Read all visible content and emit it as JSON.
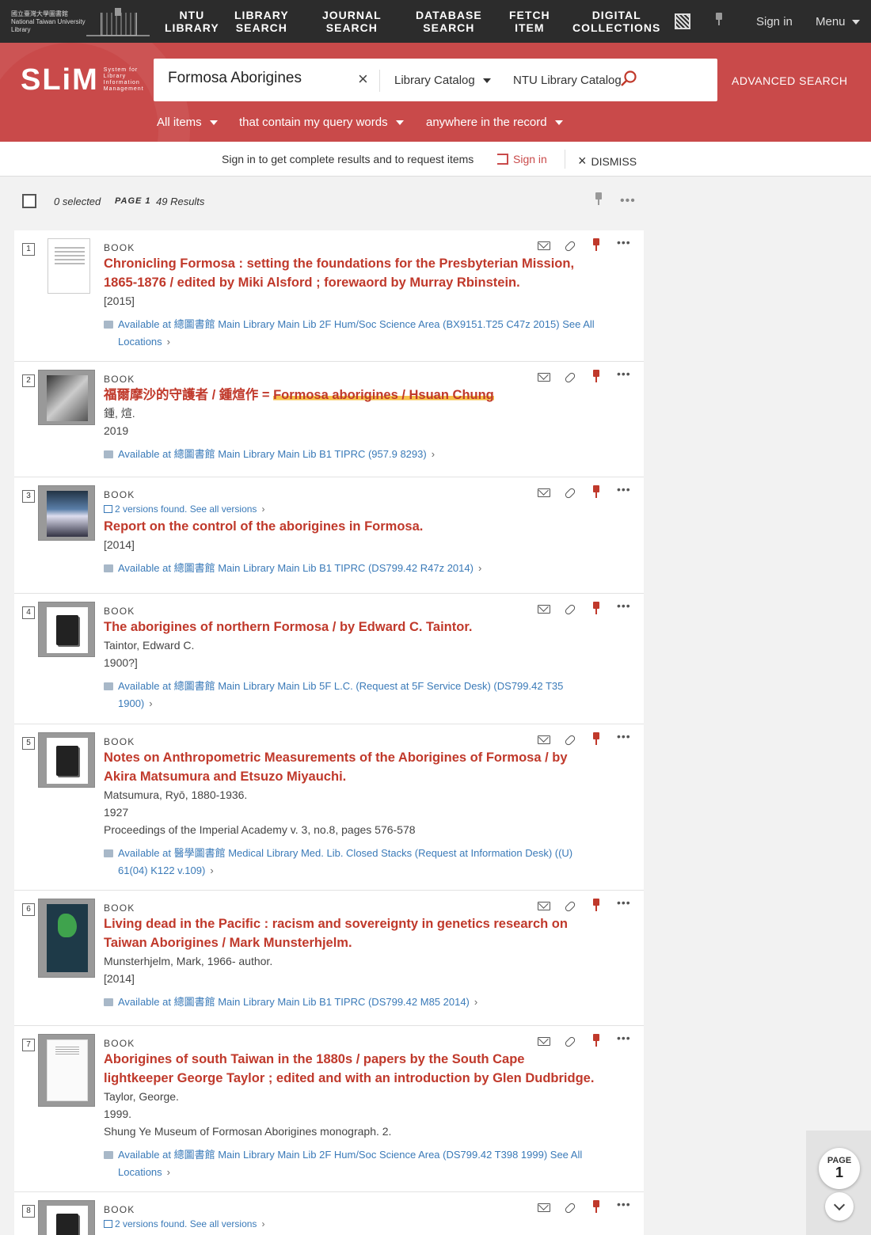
{
  "topnav": {
    "logo_text": "國立臺灣大學圖書館 National Taiwan University Library",
    "items": [
      {
        "line1": "NTU",
        "line2": "LIBRARY"
      },
      {
        "line1": "LIBRARY",
        "line2": "SEARCH"
      },
      {
        "line1": "JOURNAL",
        "line2": "SEARCH"
      },
      {
        "line1": "DATABASE",
        "line2": "SEARCH"
      },
      {
        "line1": "FETCH",
        "line2": "ITEM"
      },
      {
        "line1": "DIGITAL",
        "line2": "COLLECTIONS"
      }
    ],
    "signin": "Sign in",
    "menu": "Menu"
  },
  "search": {
    "logo": "SLiM",
    "logo_sub": "System for Library Information Management",
    "query": "Formosa Aborigines",
    "scope": "Library Catalog",
    "sub_scope": "NTU Library Catalog",
    "advanced": "ADVANCED SEARCH",
    "filters": [
      "All items",
      "that contain my query words",
      "anywhere in the record"
    ]
  },
  "signbar": {
    "message": "Sign in to get complete results and to request items",
    "signin": "Sign in",
    "dismiss": "DISMISS"
  },
  "toolbar": {
    "selected": "0 selected",
    "page": "PAGE 1",
    "results": "49 Results"
  },
  "results": [
    {
      "num": "1",
      "type": "BOOK",
      "title": "Chronicling Formosa : setting the foundations for the Presbyterian Mission, 1865-1876 / edited by Miki Alsford ; forewaord by Murray Rbinstein.",
      "lines": [
        "[2015]"
      ],
      "availability": "Available at 總圖書館 Main Library  Main Lib 2F Hum/Soc Science Area (BX9151.T25 C47z 2015) See All Locations"
    },
    {
      "num": "2",
      "type": "BOOK",
      "title_pre": "福爾摩沙的守護者 / 鍾煊作 = ",
      "title_hl": "Formosa aborigines / Hsuan Chung",
      "lines": [
        "鍾, 煊.",
        "2019"
      ],
      "availability": "Available at 總圖書館 Main Library  Main Lib B1 TIPRC (957.9 8293)"
    },
    {
      "num": "3",
      "type": "BOOK",
      "versions": "2 versions found. See all versions",
      "title": "Report on the control of the aborigines in Formosa.",
      "lines": [
        "[2014]"
      ],
      "availability": "Available at 總圖書館 Main Library  Main Lib B1 TIPRC (DS799.42 R47z 2014)"
    },
    {
      "num": "4",
      "type": "BOOK",
      "title": "The aborigines of northern Formosa / by Edward C. Taintor.",
      "lines": [
        "Taintor, Edward C.",
        "1900?]"
      ],
      "availability": "Available at 總圖書館 Main Library  Main Lib 5F L.C. (Request at 5F Service Desk) (DS799.42 T35 1900)"
    },
    {
      "num": "5",
      "type": "BOOK",
      "title": "Notes on Anthropometric Measurements of the Aborigines of Formosa / by Akira Matsumura and Etsuzo Miyauchi.",
      "lines": [
        "Matsumura, Ryō, 1880-1936.",
        "1927",
        "Proceedings of the Imperial Academy v. 3, no.8, pages 576-578"
      ],
      "availability": "Available at 醫學圖書館 Medical Library  Med. Lib. Closed Stacks (Request at Information Desk) ((U) 61(04) K122 v.109)"
    },
    {
      "num": "6",
      "type": "BOOK",
      "title": "Living dead in the Pacific : racism and sovereignty in genetics research on Taiwan Aborigines / Mark Munsterhjelm.",
      "lines": [
        "Munsterhjelm, Mark, 1966- author.",
        "[2014]"
      ],
      "availability": "Available at 總圖書館 Main Library  Main Lib B1 TIPRC (DS799.42 M85 2014)"
    },
    {
      "num": "7",
      "type": "BOOK",
      "title": "Aborigines of south Taiwan in the 1880s / papers by the South Cape lightkeeper George Taylor ; edited and with an introduction by Glen Dudbridge.",
      "lines": [
        "Taylor, George.",
        "1999.",
        "Shung Ye Museum of Formosan Aborigines monograph. 2."
      ],
      "availability": "Available at 總圖書館 Main Library  Main Lib 2F Hum/Soc Science Area (DS799.42 T398 1999) See All Locations"
    },
    {
      "num": "8",
      "type": "BOOK",
      "versions": "2 versions found. See all versions"
    }
  ],
  "page_widget": {
    "label": "PAGE",
    "number": "1"
  },
  "icons": {
    "clear": "close-icon",
    "search": "search-icon",
    "email": "mail-icon",
    "permalink": "link-icon",
    "pin": "pin-icon",
    "more": "more-icon",
    "qr": "qr-code-icon"
  },
  "colors": {
    "brand_red": "#c94a4a",
    "title_red": "#c0392b",
    "link_blue": "#3a7ab8",
    "nav_bg": "#2c2c2c",
    "highlight": "#f7c04a"
  }
}
